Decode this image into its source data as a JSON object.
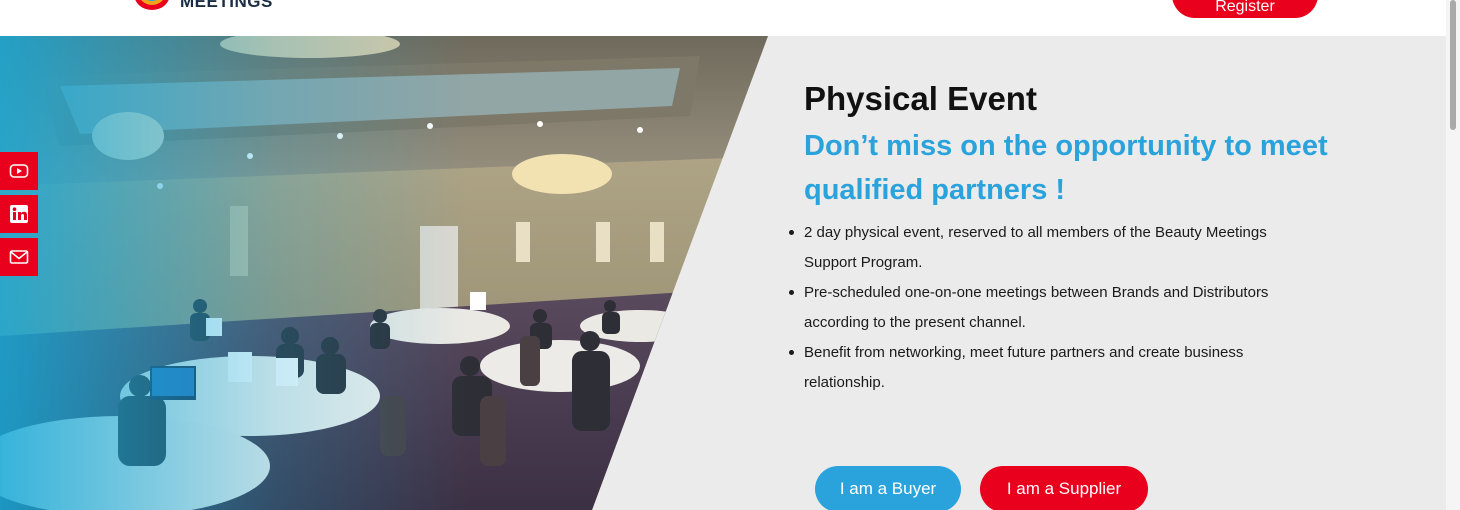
{
  "header": {
    "logo_text": "MEETINGS",
    "register_label": "Register"
  },
  "social": {
    "items": [
      "youtube",
      "linkedin",
      "email"
    ]
  },
  "hero": {
    "title": "Physical Event",
    "subtitle": "Don’t miss on the opportunity to meet qualified partners !",
    "bullets": [
      "2 day physical event, reserved to all members of the Beauty Meetings Support Program.",
      "Pre-scheduled one-on-one meetings between Brands and Distributors according to the present channel.",
      "Benefit from networking, meet future partners and create business relationship."
    ],
    "buyer_button": "I am a Buyer",
    "supplier_button": "I am a Supplier"
  },
  "colors": {
    "accent_red": "#e8001c",
    "accent_blue": "#2aa3dc",
    "panel_bg": "#ebebeb"
  }
}
